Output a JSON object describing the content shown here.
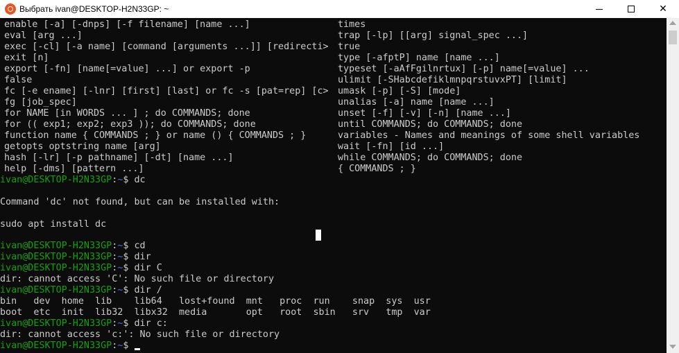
{
  "window": {
    "title": "Выбрать ivan@DESKTOP-H2N33GP: ~",
    "minimize_icon": "minimize-icon",
    "maximize_icon": "maximize-icon",
    "close_glyph": "✕"
  },
  "help_col1": [
    "enable [-a] [-dnps] [-f filename] [name ...]",
    "eval [arg ...]",
    "exec [-cl] [-a name] [command [arguments ...]] [redirecti>",
    "exit [n]",
    "export [-fn] [name[=value] ...] or export -p",
    "false",
    "fc [-e ename] [-lnr] [first] [last] or fc -s [pat=rep] [c>",
    "fg [job_spec]",
    "for NAME [in WORDS ... ] ; do COMMANDS; done",
    "for (( exp1; exp2; exp3 )); do COMMANDS; done",
    "function name { COMMANDS ; } or name () { COMMANDS ; }",
    "getopts optstring name [arg]",
    "hash [-lr] [-p pathname] [-dt] [name ...]",
    "help [-dms] [pattern ...]"
  ],
  "help_col2": [
    "times",
    "trap [-lp] [[arg] signal_spec ...]",
    "true",
    "type [-afptP] name [name ...]",
    "typeset [-aAfFgilnrtux] [-p] name[=value] ...",
    "ulimit [-SHabcdefiklmnpqrstuvxPT] [limit]",
    "umask [-p] [-S] [mode]",
    "unalias [-a] name [name ...]",
    "unset [-f] [-v] [-n] [name ...]",
    "until COMMANDS; do COMMANDS; done",
    "variables - Names and meanings of some shell variables",
    "wait [-fn] [id ...]",
    "while COMMANDS; do COMMANDS; done",
    "{ COMMANDS ; }"
  ],
  "prompt": {
    "user": "ivan@DESKTOP-H2N33GP",
    "colon": ":",
    "path": "~",
    "dollar": "$ "
  },
  "session": {
    "cmd_dc": "dc",
    "blank": "",
    "dc_not_found": "Command 'dc' not found, but can be installed with:",
    "dc_install": "sudo apt install dc",
    "cmd_cd": "cd",
    "cmd_dir": "dir",
    "cmd_dir_C": "dir C",
    "err_C": "dir: cannot access 'C': No such file or directory",
    "cmd_dir_root": "dir /",
    "ls_row1": "bin   dev  home  lib    lib64   lost+found  mnt   proc  run    snap  sys  usr",
    "ls_row2": "boot  etc  init  lib32  libx32  media       opt   root  sbin   srv   tmp  var",
    "cmd_dir_c": "dir c:",
    "err_c": "dir: cannot access 'c:': No such file or directory"
  },
  "colors": {
    "prompt_user": "#13a10e",
    "prompt_path": "#3b78ff",
    "text": "#cccccc",
    "background": "#0c0c0c"
  }
}
